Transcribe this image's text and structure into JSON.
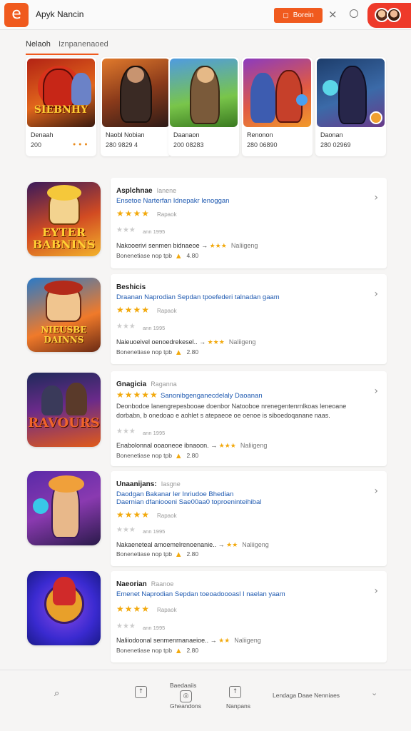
{
  "header": {
    "logo_glyph": "e",
    "title": "Apyk Nancin",
    "action_button": "Borein",
    "close_glyph": "×",
    "accent_color": "#f05a1e"
  },
  "tabs": [
    {
      "label": "Nelaoh",
      "active": true
    },
    {
      "label": "Iznpanenaoed",
      "active": false
    }
  ],
  "featured": [
    {
      "name": "Denaah",
      "stat": "200",
      "dots": "● ● ●",
      "art": "SIEBNHY"
    },
    {
      "name": "Naobl Nobian",
      "stat": "280 9829 4"
    },
    {
      "name": "Daanaon",
      "stat": "200 08283"
    },
    {
      "name": "Renonon",
      "stat": "280 06890"
    },
    {
      "name": "Daonan",
      "stat": "280 02969"
    }
  ],
  "apps": [
    {
      "icon_text": "EYTER BABNINS",
      "title": "Asplchnae",
      "title_sub": "Ianene",
      "desc": "Ensetoe Narterfan Idnepakr lenoggan",
      "stars": "★★★★",
      "stars_label": "Rapaok",
      "grey_stars": "★★★",
      "grey_meta": "ann  1995",
      "meta1_text": "Nakooerivi senmen bidnaeoe",
      "meta1_arrow": "→",
      "meta1_stars": "★★★",
      "meta1_right": "Naliigeng",
      "meta2_text": "Bonenetiase nop tpb",
      "meta2_fire": "▲",
      "meta2_num": "4.80"
    },
    {
      "icon_text": "NIEUSBE DAINNS",
      "title": "Beshicis",
      "title_sub": "",
      "desc": "Draanan Naprodian Sepdan tpoefederi talnadan gaam",
      "stars": "★★★★",
      "stars_label": "Rapaok",
      "grey_stars": "★★★",
      "grey_meta": "ann  1995",
      "meta1_text": "Naieuoeivel oenoedrekesel..",
      "meta1_arrow": "→",
      "meta1_stars": "★★★",
      "meta1_right": "Naliigeng",
      "meta2_text": "Bonenetiase nop tpb",
      "meta2_fire": "▲",
      "meta2_num": "2.80"
    },
    {
      "icon_text": "RAVOURS",
      "title": "Gnagicia",
      "title_sub": "Raganna",
      "desc": "Sanonibgenganecdelaly Daoanan",
      "desc2": "Deonbodoe lanengrepesbooae doenbor Natooboe nrenegentenrnlkoas leneoane dorbabn, b onedoao e aohlet s atepaeoe oe oenoe is siboedoqanane naas.",
      "stars": "★★★★★",
      "stars_label": "",
      "grey_stars": "★★★",
      "grey_meta": "ann  1995",
      "meta1_text": "Enabolonnal ooaoneoe ibnaoon.",
      "meta1_arrow": "→",
      "meta1_stars": "★★★",
      "meta1_right": "Naliigeng",
      "meta2_text": "Bonenetiase nop tpb",
      "meta2_fire": "▲",
      "meta2_num": "2.80"
    },
    {
      "icon_text": "",
      "title": "Unaanijans:",
      "title_sub": "Iasgne",
      "desc": "Daodgan Bakanar ler Inriudoe Bhedian",
      "desc2_blue": "Daernian dfaniooeni Sae00aa0 toproeninteihibal",
      "stars": "★★★★",
      "stars_label": "Rapaok",
      "grey_stars": "★★★",
      "grey_meta": "ann  1995",
      "meta1_text": "Nakaeneteal amoemelrenoenanie..",
      "meta1_arrow": "→",
      "meta1_stars": "★★",
      "meta1_right": "Naliigeng",
      "meta2_text": "Bonenetiase nop tpb",
      "meta2_fire": "▲",
      "meta2_num": "2.80"
    },
    {
      "icon_text": "",
      "title": "Naeorian",
      "title_sub": "Raanoe",
      "desc": "Emenet Naprodian Sepdan toeoadoooasl I naelan yaam",
      "stars": "★★★★",
      "stars_label": "Rapaok",
      "grey_stars": "★★★",
      "grey_meta": "ann  1995",
      "meta1_text": "Naliiodoonal senmenrnanaeioe..",
      "meta1_arrow": "→",
      "meta1_stars": "★★",
      "meta1_right": "Naliigeng",
      "meta2_text": "Bonenetiase nop tpb",
      "meta2_fire": "▲",
      "meta2_num": "2.80"
    }
  ],
  "bottom_nav": {
    "search_glyph": "⌕",
    "item1_top": "Baedaaiis",
    "item1_label": "Gheandons",
    "item2_label": "Nanpans",
    "right_text": "Lendaga Daae Nenniaes",
    "chevron": "⌄"
  }
}
